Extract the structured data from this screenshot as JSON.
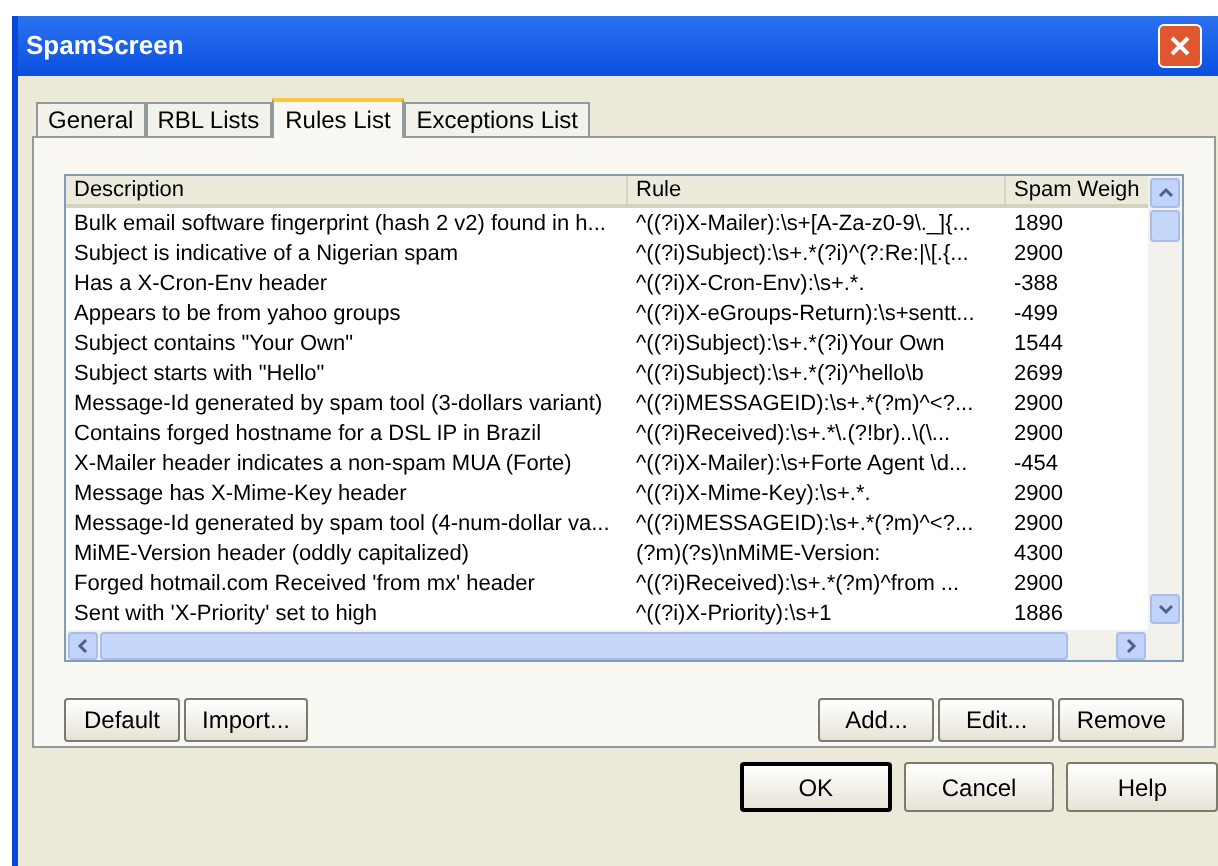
{
  "window": {
    "title": "SpamScreen"
  },
  "tabs": [
    {
      "label": "General",
      "selected": false
    },
    {
      "label": "RBL Lists",
      "selected": false
    },
    {
      "label": "Rules List",
      "selected": true
    },
    {
      "label": "Exceptions List",
      "selected": false
    }
  ],
  "table": {
    "columns": [
      "Description",
      "Rule",
      "Spam Weigh"
    ],
    "rows": [
      [
        "Bulk email software fingerprint (hash 2 v2) found in h...",
        "^((?i)X-Mailer):\\s+[A-Za-z0-9\\._]{...",
        "1890"
      ],
      [
        "Subject is indicative of a Nigerian spam",
        "^((?i)Subject):\\s+.*(?i)^(?:Re:|\\[.{...",
        "2900"
      ],
      [
        "Has a X-Cron-Env header",
        "^((?i)X-Cron-Env):\\s+.*.",
        "-388"
      ],
      [
        "Appears to be from yahoo groups",
        "^((?i)X-eGroups-Return):\\s+sentt...",
        "-499"
      ],
      [
        "Subject contains \"Your Own\"",
        "^((?i)Subject):\\s+.*(?i)Your Own",
        "1544"
      ],
      [
        "Subject starts with \"Hello\"",
        "^((?i)Subject):\\s+.*(?i)^hello\\b",
        "2699"
      ],
      [
        "Message-Id generated by spam tool (3-dollars variant)",
        "^((?i)MESSAGEID):\\s+.*(?m)^<?...",
        "2900"
      ],
      [
        "Contains forged hostname for a DSL IP in Brazil",
        "^((?i)Received):\\s+.*\\.(?!br)..\\(\\...",
        "2900"
      ],
      [
        "X-Mailer header indicates a non-spam MUA (Forte)",
        "^((?i)X-Mailer):\\s+Forte Agent \\d...",
        "-454"
      ],
      [
        "Message has X-Mime-Key header",
        "^((?i)X-Mime-Key):\\s+.*.",
        "2900"
      ],
      [
        "Message-Id generated by spam tool (4-num-dollar va...",
        "^((?i)MESSAGEID):\\s+.*(?m)^<?...",
        "2900"
      ],
      [
        "MiME-Version header (oddly capitalized)",
        "(?m)(?s)\\nMiME-Version:",
        "4300"
      ],
      [
        "Forged hotmail.com Received 'from mx' header",
        "^((?i)Received):\\s+.*(?m)^from ...",
        "2900"
      ],
      [
        "Sent with 'X-Priority' set to high",
        "^((?i)X-Priority):\\s+1",
        "1886"
      ]
    ]
  },
  "list_buttons_left": [
    "Default",
    "Import..."
  ],
  "list_buttons_right": [
    "Add...",
    "Edit...",
    "Remove"
  ],
  "dialog_buttons": [
    {
      "label": "OK",
      "default": true
    },
    {
      "label": "Cancel",
      "default": false
    },
    {
      "label": "Help",
      "default": false
    }
  ]
}
